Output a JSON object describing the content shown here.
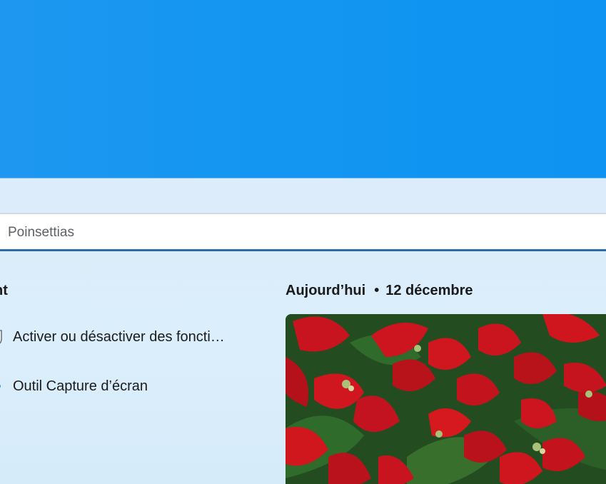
{
  "search": {
    "value": "Poinsettias"
  },
  "recent": {
    "title": "nt",
    "items": [
      {
        "label": "Activer ou désactiver des foncti…",
        "icon": "shield-icon"
      },
      {
        "label": "Outil Capture d’écran",
        "icon": "snipping-tool-icon"
      }
    ]
  },
  "today": {
    "label": "Aujourd’hui",
    "separator": "•",
    "date": "12 décembre"
  },
  "colors": {
    "banner": "#1296f1",
    "panel": "#dcedf9",
    "search_underline": "#2d6aa8",
    "text": "#1b1b1b",
    "poinsettia_red": "#c8141e",
    "leaf_green": "#2f6b2a"
  }
}
